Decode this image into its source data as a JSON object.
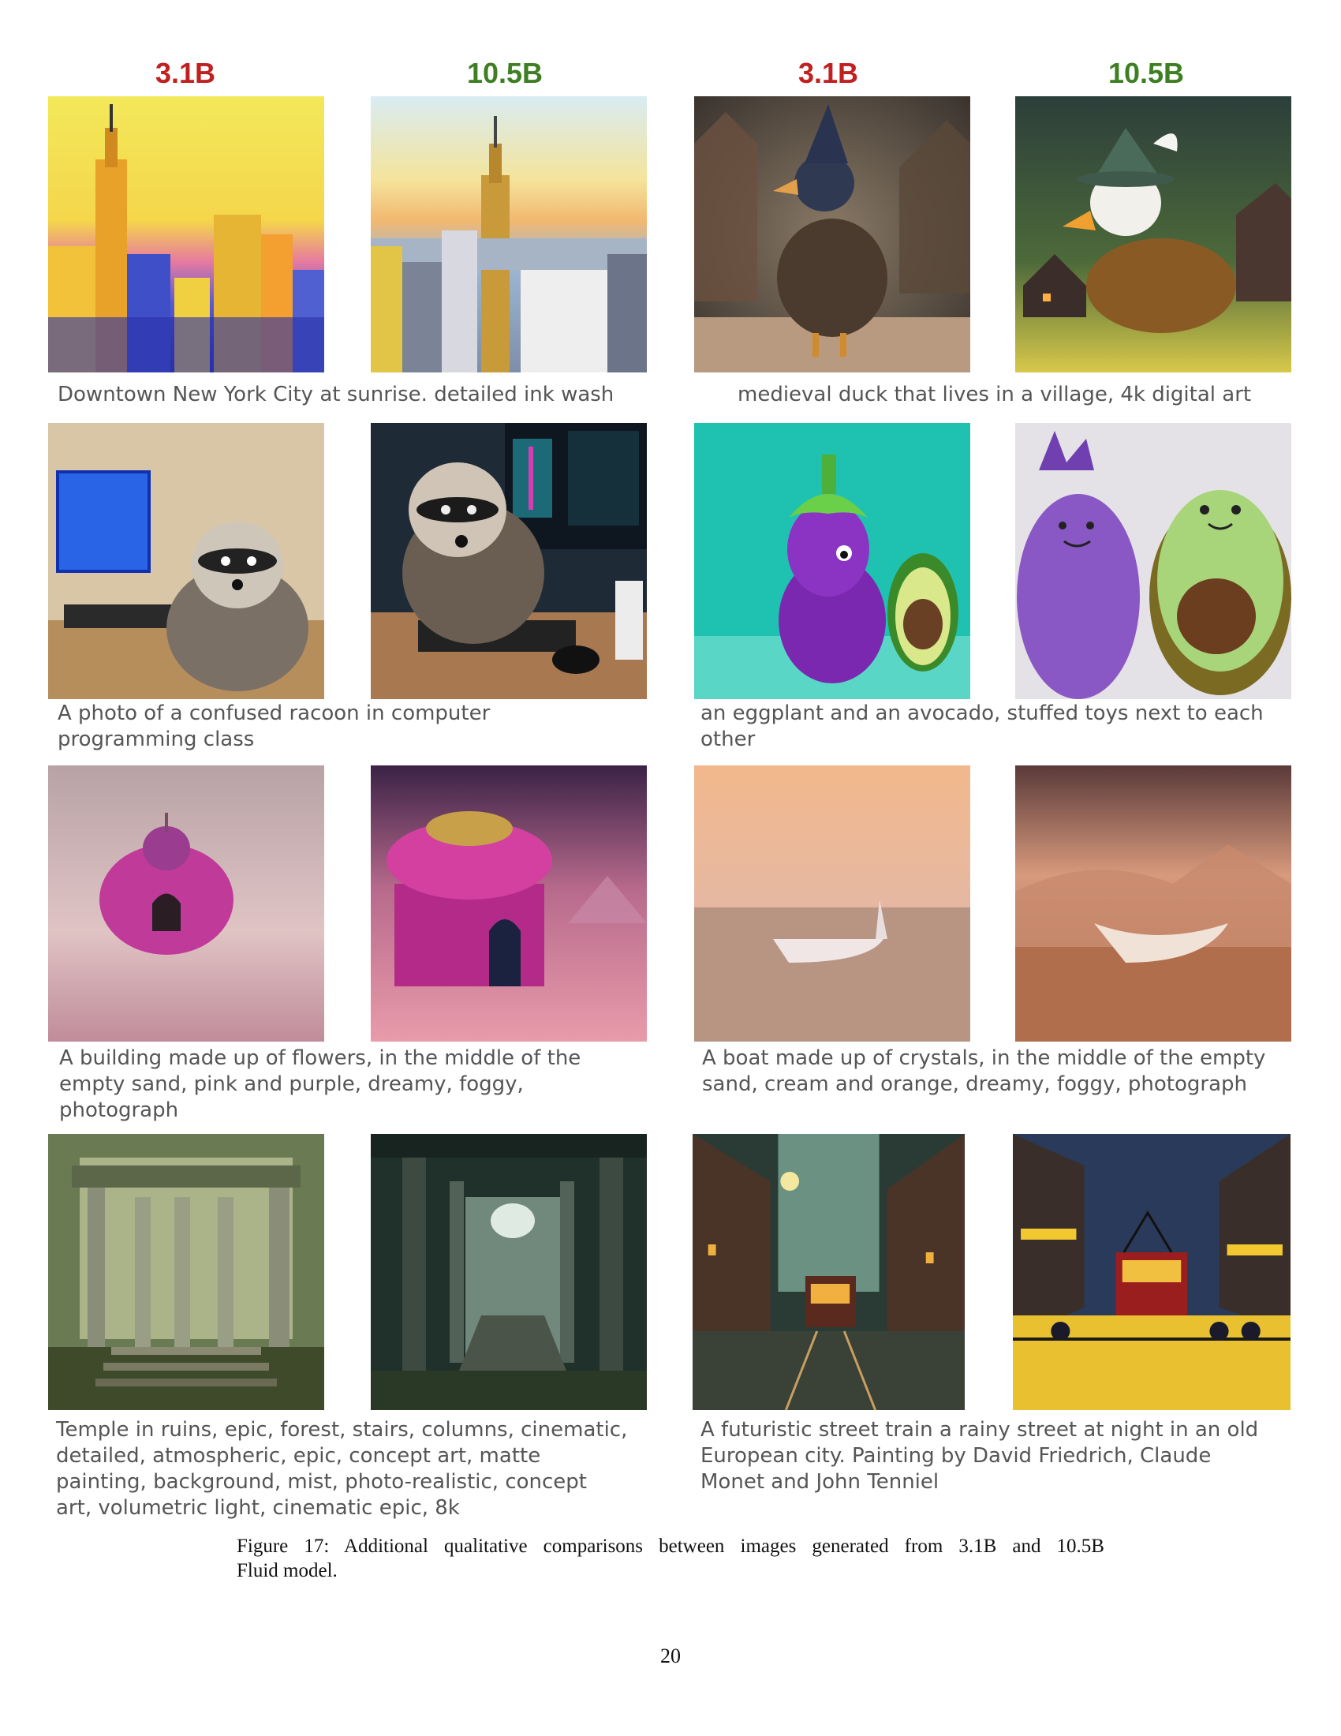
{
  "headers": {
    "col1": "3.1B",
    "col2": "10.5B",
    "col3": "3.1B",
    "col4": "10.5B"
  },
  "captions": {
    "nyc": "Downtown New York City at sunrise. detailed ink wash",
    "duck": "medieval duck that lives in a village, 4k digital art",
    "racoon_l1": "A photo of a confused racoon in computer",
    "racoon_l2": "programming class",
    "toys_l1": "an eggplant and an avocado, stuffed toys next to each",
    "toys_l2": "other",
    "flowers_l1": "A building made up of flowers, in the middle of the",
    "flowers_l2": "empty sand, pink and purple, dreamy, foggy,",
    "flowers_l3": "photograph",
    "boat_l1": "A boat made up of crystals, in the middle of the empty",
    "boat_l2": "sand, cream and orange, dreamy, foggy, photograph",
    "temple_l1": "Temple in ruins, epic, forest, stairs, columns, cinematic,",
    "temple_l2": "detailed, atmospheric, epic, concept art, matte",
    "temple_l3": "painting, background, mist, photo-realistic, concept",
    "temple_l4": "art, volumetric light, cinematic epic, 8k",
    "train_l1": "A futuristic street train a rainy street at night in an old",
    "train_l2": "European city. Painting by David Friedrich, Claude",
    "train_l3": "Monet and John Tenniel"
  },
  "figure_caption": {
    "line1": "Figure 17:  Additional qualitative comparisons between images generated from 3.1B and 10.5B",
    "line2": "Fluid model."
  },
  "page_number": "20",
  "colors": {
    "header_red": "#c0201f",
    "header_green": "#3d7f22",
    "caption_gray": "#555555"
  }
}
